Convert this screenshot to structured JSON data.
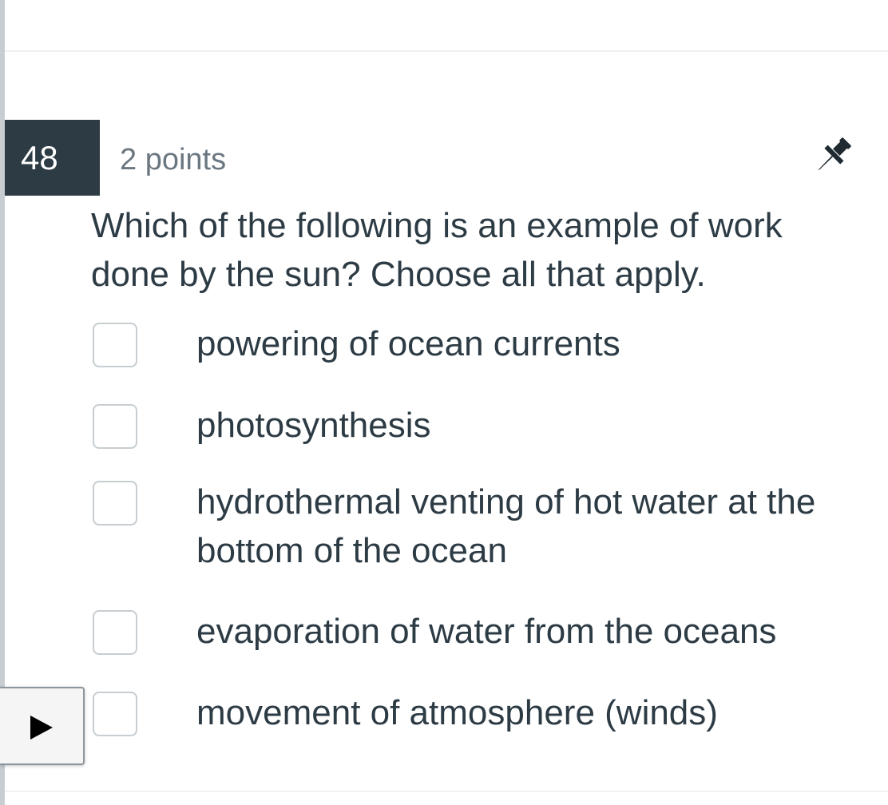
{
  "question": {
    "number": "48",
    "points": "2 points",
    "text": "Which of the following is an example of work done by the sun?  Choose all that apply."
  },
  "icons": {
    "pin": "pin-icon",
    "nav_toggle": "play-triangle-icon"
  },
  "colors": {
    "number_badge": "#2d3b45",
    "text": "#2d3b45",
    "points_text": "#6b7780",
    "checkbox_border": "#c7cdd1"
  },
  "answers": [
    {
      "label": "powering of ocean currents",
      "checked": false
    },
    {
      "label": "photosynthesis",
      "checked": false
    },
    {
      "label": "hydrothermal venting of hot water at the bottom of the ocean",
      "checked": false
    },
    {
      "label": "evaporation of water from the oceans",
      "checked": false
    },
    {
      "label": "movement of atmosphere (winds)",
      "checked": false
    }
  ]
}
